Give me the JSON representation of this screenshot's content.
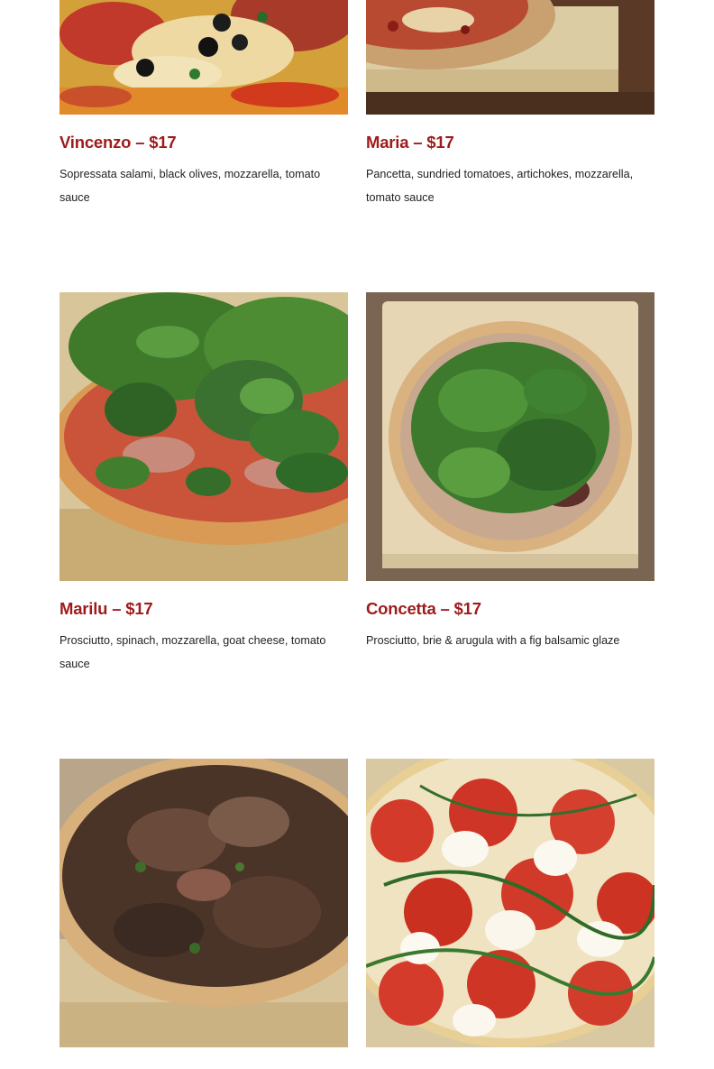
{
  "menu": {
    "items": [
      {
        "title": "Vincenzo – $17",
        "description": "Sopressata salami, black olives, mozzarella, tomato sauce",
        "image": "vincenzo-pizza-photo"
      },
      {
        "title": "Maria – $17",
        "description": "Pancetta, sundried tomatoes, artichokes, mozzarella, tomato sauce",
        "image": "maria-pizza-photo"
      },
      {
        "title": "Marilu – $17",
        "description": "Prosciutto, spinach, mozzarella, goat cheese, tomato sauce",
        "image": "marilu-pizza-photo"
      },
      {
        "title": "Concetta – $17",
        "description": "Prosciutto, brie & arugula with a fig balsamic glaze",
        "image": "concetta-pizza-photo"
      },
      {
        "title": "",
        "description": "",
        "image": "mushroom-pizza-photo"
      },
      {
        "title": "",
        "description": "",
        "image": "caprese-pizza-photo"
      }
    ]
  },
  "colors": {
    "title": "#9e1b1b",
    "text": "#222222",
    "background": "#ffffff"
  }
}
